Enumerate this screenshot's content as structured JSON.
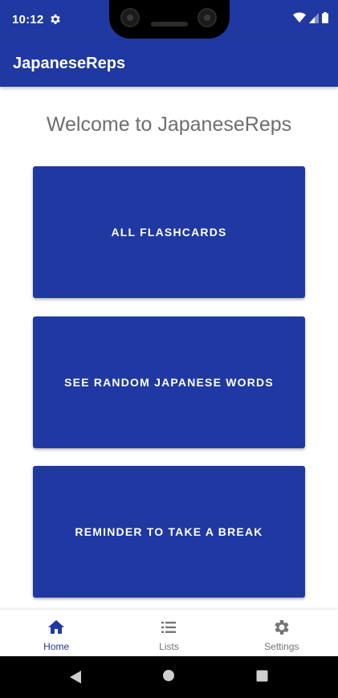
{
  "status_bar": {
    "time": "10:12",
    "icons": [
      "gear-icon",
      "wifi-icon",
      "signal-icon",
      "battery-icon"
    ]
  },
  "app_bar": {
    "title": "JapaneseReps"
  },
  "main": {
    "welcome_text": "Welcome to JapaneseReps",
    "buttons": [
      {
        "label": "ALL FLASHCARDS"
      },
      {
        "label": "SEE RANDOM JAPANESE WORDS"
      },
      {
        "label": "REMINDER TO TAKE A BREAK"
      }
    ]
  },
  "bottom_nav": {
    "items": [
      {
        "label": "Home",
        "icon": "home-icon",
        "active": true
      },
      {
        "label": "Lists",
        "icon": "list-icon",
        "active": false
      },
      {
        "label": "Settings",
        "icon": "settings-icon",
        "active": false
      }
    ]
  },
  "colors": {
    "primary": "#2038a1",
    "background": "#ffffff",
    "welcome_text": "#6e6e6e",
    "nav_inactive": "#757575"
  }
}
